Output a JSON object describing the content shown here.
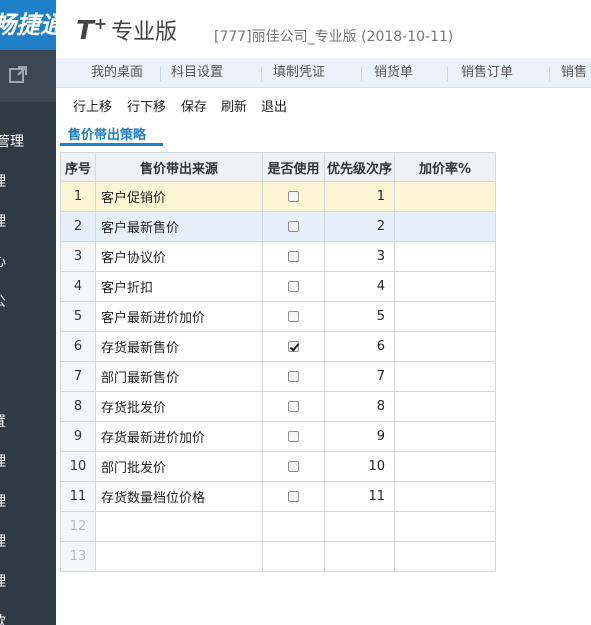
{
  "sidebar": {
    "brand": "畅捷通",
    "items": [
      "管理",
      "理",
      "理",
      "心",
      "公",
      "置",
      "理",
      "理",
      "理",
      "理",
      "款"
    ]
  },
  "header": {
    "product": "T",
    "product_sup": "+",
    "edition": "专业版",
    "company": "[777]丽佳公司_专业版   (2018-10-11)"
  },
  "tabs": [
    "我的桌面",
    "科目设置",
    "填制凭证",
    "销货单",
    "销售订单",
    "销售"
  ],
  "toolbar": {
    "move_up": "行上移",
    "move_down": "行下移",
    "save": "保存",
    "refresh": "刷新",
    "exit": "退出"
  },
  "subtab": {
    "label": "售价带出策略"
  },
  "table": {
    "headers": [
      "序号",
      "售价带出来源",
      "是否使用",
      "优先级次序",
      "加价率%"
    ],
    "rows": [
      {
        "seq": "1",
        "source": "客户促销价",
        "used": false,
        "priority": "1",
        "markup": ""
      },
      {
        "seq": "2",
        "source": "客户最新售价",
        "used": false,
        "priority": "2",
        "markup": ""
      },
      {
        "seq": "3",
        "source": "客户协议价",
        "used": false,
        "priority": "3",
        "markup": ""
      },
      {
        "seq": "4",
        "source": "客户折扣",
        "used": false,
        "priority": "4",
        "markup": ""
      },
      {
        "seq": "5",
        "source": "客户最新进价加价",
        "used": false,
        "priority": "5",
        "markup": ""
      },
      {
        "seq": "6",
        "source": "存货最新售价",
        "used": true,
        "priority": "6",
        "markup": ""
      },
      {
        "seq": "7",
        "source": "部门最新售价",
        "used": false,
        "priority": "7",
        "markup": ""
      },
      {
        "seq": "8",
        "source": "存货批发价",
        "used": false,
        "priority": "8",
        "markup": ""
      },
      {
        "seq": "9",
        "source": "存货最新进价加价",
        "used": false,
        "priority": "9",
        "markup": ""
      },
      {
        "seq": "10",
        "source": "部门批发价",
        "used": false,
        "priority": "10",
        "markup": ""
      },
      {
        "seq": "11",
        "source": "存货数量档位价格",
        "used": false,
        "priority": "11",
        "markup": ""
      }
    ],
    "empty_rows": [
      "12",
      "13"
    ]
  }
}
